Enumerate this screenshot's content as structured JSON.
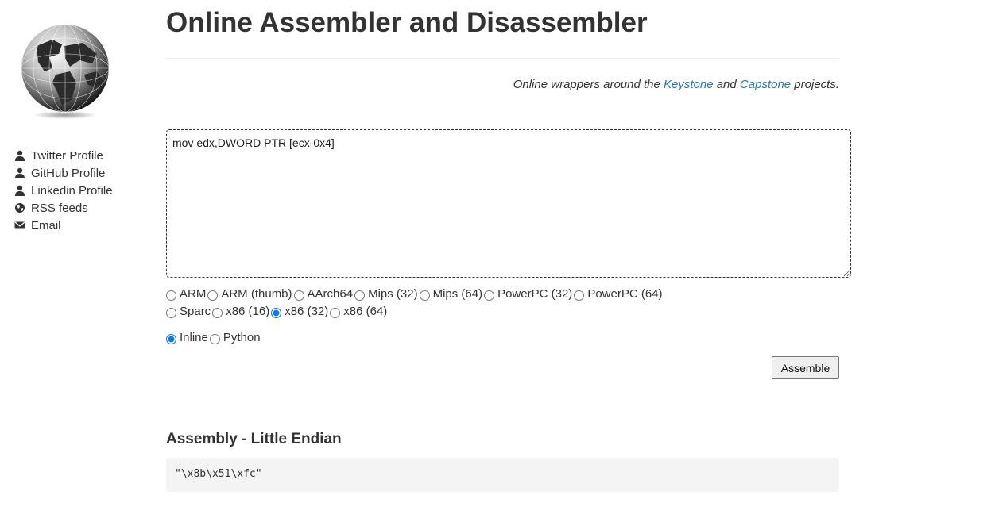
{
  "sidebar": {
    "links": [
      {
        "label": "Twitter Profile",
        "icon": "user-icon"
      },
      {
        "label": "GitHub Profile",
        "icon": "user-icon"
      },
      {
        "label": "Linkedin Profile",
        "icon": "user-icon"
      },
      {
        "label": "RSS feeds",
        "icon": "globe-icon"
      },
      {
        "label": "Email",
        "icon": "envelope-icon"
      }
    ]
  },
  "header": {
    "title": "Online Assembler and Disassembler",
    "tagline_prefix": "Online wrappers around the ",
    "keystone_link": "Keystone",
    "tagline_and": " and ",
    "capstone_link": "Capstone",
    "tagline_suffix": " projects."
  },
  "editor": {
    "value": "mov edx,DWORD PTR [ecx-0x4]"
  },
  "architectures": {
    "row1": [
      "ARM",
      "ARM (thumb)",
      "AArch64",
      "Mips (32)",
      "Mips (64)",
      "PowerPC (32)",
      "PowerPC (64)"
    ],
    "row2": [
      "Sparc",
      "x86 (16)",
      "x86 (32)",
      "x86 (64)"
    ],
    "selected": "x86 (32)"
  },
  "output_format": {
    "options": [
      "Inline",
      "Python"
    ],
    "selected": "Inline"
  },
  "assemble_button": "Assemble",
  "result": {
    "title": "Assembly - Little Endian",
    "value": "\"\\x8b\\x51\\xfc\""
  },
  "colors": {
    "link": "#2a7ab8",
    "text": "#333333",
    "result_bg": "#f4f4f4"
  }
}
